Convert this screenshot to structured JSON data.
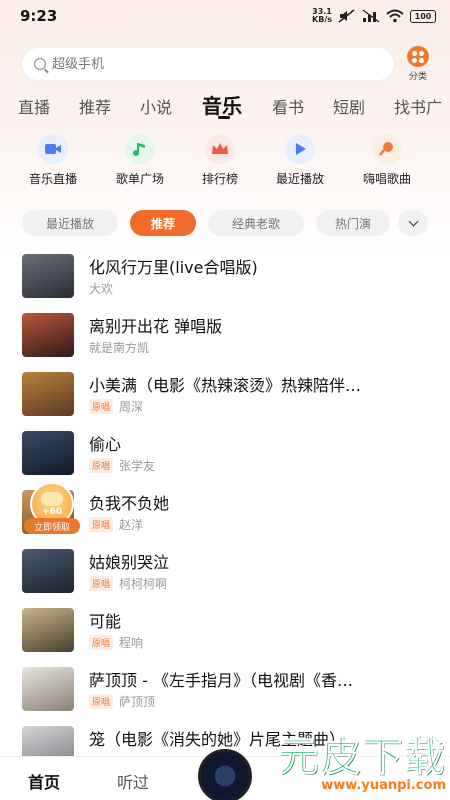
{
  "status_bar": {
    "time": "9:23",
    "net_speed_value": "33.1",
    "net_speed_unit": "KB/s",
    "battery": "100"
  },
  "search": {
    "placeholder": "超级手机"
  },
  "category": {
    "label": "分类"
  },
  "tabs": [
    {
      "label": "直播"
    },
    {
      "label": "推荐"
    },
    {
      "label": "小说"
    },
    {
      "label": "音乐",
      "active": true
    },
    {
      "label": "看书"
    },
    {
      "label": "短剧"
    },
    {
      "label": "找书广"
    }
  ],
  "quick_entries": [
    {
      "label": "音乐直播",
      "icon": "video-camera-icon",
      "color": "#4a7bf0",
      "bg": "#e7eefd"
    },
    {
      "label": "歌单广场",
      "icon": "music-note-icon",
      "color": "#34b46a",
      "bg": "#e5f6ec"
    },
    {
      "label": "排行榜",
      "icon": "crown-icon",
      "color": "#f15a3a",
      "bg": "#fde9e3"
    },
    {
      "label": "最近播放",
      "icon": "play-icon",
      "color": "#4a7bf0",
      "bg": "#e7eefd"
    },
    {
      "label": "嗨唱歌曲",
      "icon": "microphone-icon",
      "color": "#f07a3a",
      "bg": "#fdeee3"
    }
  ],
  "chips": [
    {
      "label": "最近播放"
    },
    {
      "label": "推荐",
      "active": true
    },
    {
      "label": "经典老歌"
    },
    {
      "label": "热门演"
    }
  ],
  "songs": [
    {
      "title": "化风行万里(live合唱版)",
      "artist": "大欢",
      "badge": ""
    },
    {
      "title": "离别开出花 弹唱版",
      "artist": "就是南方凯",
      "badge": ""
    },
    {
      "title": "小美满（电影《热辣滚烫》热辣陪伴…",
      "artist": "周深",
      "badge": "原唱"
    },
    {
      "title": "偷心",
      "artist": "张学友",
      "badge": "原唱"
    },
    {
      "title": "负我不负她",
      "artist": "赵洋",
      "badge": "原唱"
    },
    {
      "title": "姑娘别哭泣",
      "artist": "柯柯柯啊",
      "badge": "原唱"
    },
    {
      "title": "可能",
      "artist": "程响",
      "badge": "原唱"
    },
    {
      "title": "萨顶顶 - 《左手指月》（电视剧《香…",
      "artist": "萨顶顶",
      "badge": "原唱"
    },
    {
      "title": "笼（电影《消失的她》片尾主题曲）",
      "artist": "",
      "badge": ""
    }
  ],
  "coin_float": {
    "amount": "+60",
    "claim_label": "立即领取"
  },
  "bottom_nav": {
    "home": "首页",
    "listened": "听过"
  },
  "watermark": {
    "main": "元皮下载",
    "sub": "www.yuanpi.com"
  }
}
